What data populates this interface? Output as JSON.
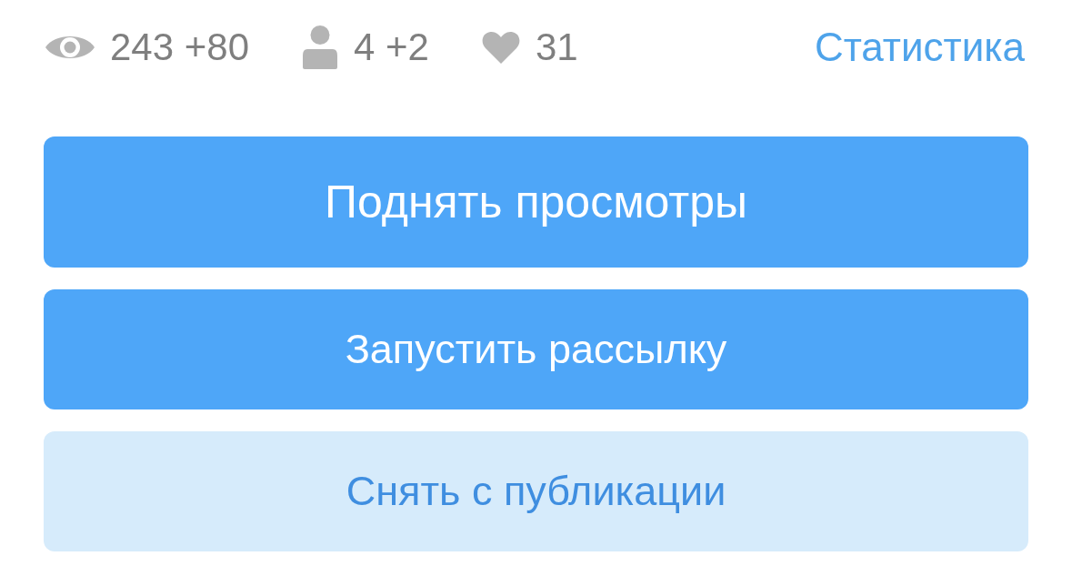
{
  "stats": [
    {
      "kind": "views",
      "text": "243 +80"
    },
    {
      "kind": "visitors",
      "text": "4 +2"
    },
    {
      "kind": "likes",
      "text": "31"
    }
  ],
  "stats_link": "Статистика",
  "buttons": [
    {
      "kind": "large",
      "label": "Поднять просмотры"
    },
    {
      "kind": "primary",
      "label": "Запустить рассылку"
    },
    {
      "kind": "secondary",
      "label": "Снять с публикации"
    }
  ]
}
